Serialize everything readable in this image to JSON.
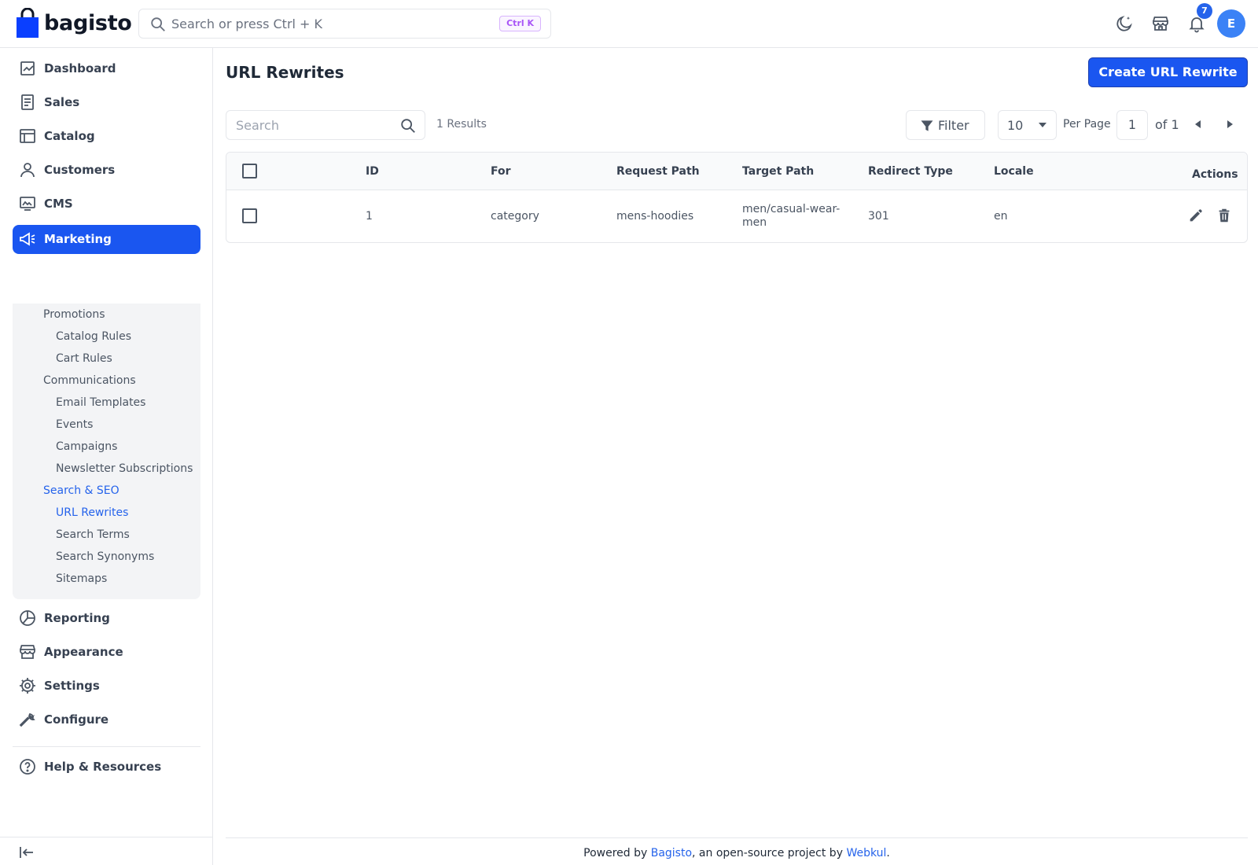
{
  "brand": {
    "name": "bagisto"
  },
  "header": {
    "search_placeholder": "Search or press Ctrl + K",
    "shortcut": "Ctrl K",
    "notification_count": "7",
    "avatar_initial": "E",
    "icons": [
      "moon-icon",
      "storefront-icon",
      "bell-icon"
    ]
  },
  "sidebar": {
    "items": [
      {
        "label": "Dashboard",
        "icon": "dashboard-icon"
      },
      {
        "label": "Sales",
        "icon": "receipt-icon"
      },
      {
        "label": "Catalog",
        "icon": "catalog-icon"
      },
      {
        "label": "Customers",
        "icon": "user-icon"
      },
      {
        "label": "CMS",
        "icon": "monitor-icon"
      },
      {
        "label": "Marketing",
        "icon": "megaphone-icon"
      },
      {
        "label": "Reporting",
        "icon": "pie-icon"
      },
      {
        "label": "Appearance",
        "icon": "store-icon"
      },
      {
        "label": "Settings",
        "icon": "gear-icon"
      },
      {
        "label": "Configure",
        "icon": "wrench-icon"
      },
      {
        "label": "Help & Resources",
        "icon": "help-icon"
      }
    ],
    "submenu": {
      "promotions": "Promotions",
      "catalog_rules": "Catalog Rules",
      "cart_rules": "Cart Rules",
      "communications": "Communications",
      "email_templates": "Email Templates",
      "events": "Events",
      "campaigns": "Campaigns",
      "newsletter": "Newsletter Subscriptions",
      "search_seo": "Search & SEO",
      "url_rewrites": "URL Rewrites",
      "search_terms": "Search Terms",
      "search_synonyms": "Search Synonyms",
      "sitemaps": "Sitemaps"
    },
    "active": "Marketing",
    "active_sub": "URL Rewrites",
    "active_color": "#1a56f0"
  },
  "main": {
    "title": "URL Rewrites",
    "create_label": "Create URL Rewrite",
    "search_placeholder": "Search",
    "results": "1 Results",
    "filter_label": "Filter",
    "per_page_value": "10",
    "per_page_label": "Per Page",
    "page": "1",
    "page_of": "of 1"
  },
  "table": {
    "columns": [
      "ID",
      "For",
      "Request Path",
      "Target Path",
      "Redirect Type",
      "Locale",
      "Actions"
    ],
    "rows": [
      {
        "id": "1",
        "for": "category",
        "request_path": "mens-hoodies",
        "target_path_1": "men/casual-wear-",
        "target_path_2": "men",
        "redirect_type": "301",
        "locale": "en"
      }
    ]
  },
  "footer": {
    "prefix": "Powered by ",
    "link1": "Bagisto",
    "middle": ", an open-source project by ",
    "link2": "Webkul",
    "suffix": "."
  }
}
